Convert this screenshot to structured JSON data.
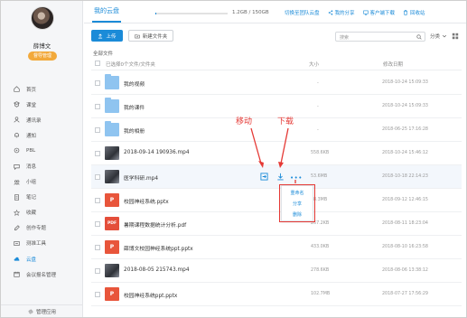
{
  "user": {
    "name": "薛博文",
    "role": "督导管理"
  },
  "sidebar": {
    "items": [
      {
        "label": "首页",
        "icon": "home-icon"
      },
      {
        "label": "课堂",
        "icon": "classroom-icon"
      },
      {
        "label": "通讯录",
        "icon": "contacts-icon"
      },
      {
        "label": "通知",
        "icon": "bell-icon"
      },
      {
        "label": "PBL",
        "icon": "pbl-icon"
      },
      {
        "label": "消息",
        "icon": "message-icon"
      },
      {
        "label": "小组",
        "icon": "group-icon"
      },
      {
        "label": "笔记",
        "icon": "note-icon"
      },
      {
        "label": "收藏",
        "icon": "star-icon"
      },
      {
        "label": "创作专题",
        "icon": "create-icon"
      },
      {
        "label": "测准工具",
        "icon": "tool-icon"
      },
      {
        "label": "云盘",
        "icon": "cloud-icon",
        "active": true
      },
      {
        "label": "会议报名管理",
        "icon": "meeting-icon"
      }
    ],
    "footer": "管理应用"
  },
  "topbar": {
    "tab": "我的云盘",
    "quota": "1.2GB / 150GB",
    "quota_fraction": 0.008,
    "actions": [
      "切换至团队云盘",
      "我的分享",
      "客户端下载",
      "回收站"
    ]
  },
  "toolbar": {
    "upload": "上传",
    "new_folder": "新建文件夹",
    "search_placeholder": "搜索",
    "sort": "分类"
  },
  "table": {
    "breadcrumb": "全部文件",
    "header": {
      "name": "已选择0个文件/文件夹",
      "size": "大小",
      "date": "修改日期"
    },
    "rows": [
      {
        "type": "folder",
        "name": "我的视频",
        "size": "-",
        "date": "2018-10-24 15:09:33"
      },
      {
        "type": "folder",
        "name": "我的课件",
        "size": "-",
        "date": "2018-10-24 15:09:33"
      },
      {
        "type": "folder",
        "name": "我的相册",
        "size": "-",
        "date": "2018-06-25 17:16:28"
      },
      {
        "type": "img",
        "name": "2018-09-14 190936.mp4",
        "size": "558.6KB",
        "date": "2018-10-24 15:46:12"
      },
      {
        "type": "img",
        "name": "医学科研.mp4",
        "size": "53.6MB",
        "date": "2018-10-18 22:14:23"
      },
      {
        "type": "ppt",
        "name": "校园神经系统.pptx",
        "size": "28.3MB",
        "date": "2018-09-12 12:46:15"
      },
      {
        "type": "pdf",
        "name": "暑期课程数据统计分析.pdf",
        "size": "267.2KB",
        "date": "2018-08-11 18:23:04"
      },
      {
        "type": "ppt",
        "name": "薛博文校园神经系统ppt.pptx",
        "size": "433.0KB",
        "date": "2018-08-10 16:23:58"
      },
      {
        "type": "img",
        "name": "2018-08-05 215743.mp4",
        "size": "278.6KB",
        "date": "2018-08-06 13:38:12"
      },
      {
        "type": "ppt",
        "name": "校园神经系统ppt.pptx",
        "size": "102.7MB",
        "date": "2018-07-27 17:56:29"
      }
    ]
  },
  "dropdown": [
    "重命名",
    "分享",
    "删除"
  ],
  "annotations": {
    "move": "移动",
    "download": "下载"
  },
  "colors": {
    "accent": "#1b8bd8",
    "annotation": "#e53935",
    "badge": "#f2a93b"
  }
}
